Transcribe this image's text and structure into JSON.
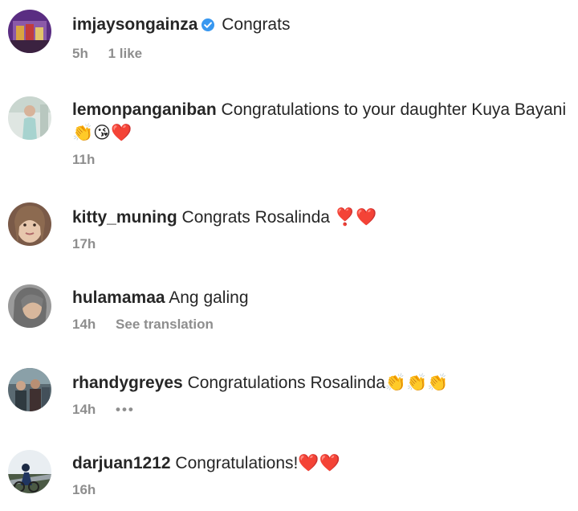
{
  "comments": [
    {
      "username": "imjaysongainza",
      "verified": true,
      "text": "Congrats",
      "emojis": "",
      "time": "5h",
      "likes": "1 like"
    },
    {
      "username": "lemonpanganiban",
      "verified": false,
      "text": "Congratulations to your daughter Kuya Bayani",
      "emojis": "👏😘❤️",
      "time": "11h"
    },
    {
      "username": "kitty_muning",
      "verified": false,
      "text": "Congrats Rosalinda",
      "emojis": "❣️❤️",
      "time": "17h"
    },
    {
      "username": "hulamamaa",
      "verified": false,
      "text": "Ang galing",
      "emojis": "",
      "time": "14h",
      "translate": "See translation"
    },
    {
      "username": "rhandygreyes",
      "verified": false,
      "text": "Congratulations Rosalinda",
      "emojis": "👏👏👏",
      "time": "14h",
      "more": "•••"
    },
    {
      "username": "darjuan1212",
      "verified": false,
      "text": "Congratulations!",
      "emojis": "❤️❤️",
      "time": "16h"
    }
  ],
  "colors": {
    "text": "#262626",
    "meta": "#8e8e8e",
    "verified": "#3797f0"
  }
}
